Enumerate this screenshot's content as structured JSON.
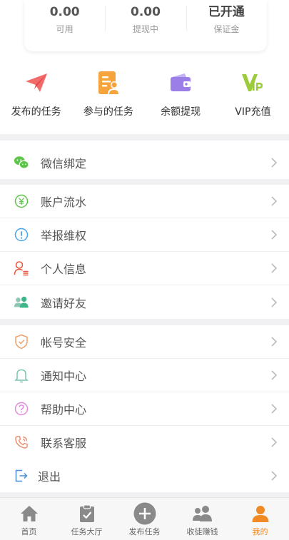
{
  "stats": [
    {
      "value": "0.00",
      "label": "可用"
    },
    {
      "value": "0.00",
      "label": "提现中"
    },
    {
      "value": "已开通",
      "label": "保证金"
    }
  ],
  "quick_actions": [
    {
      "label": "发布的任务",
      "icon": "paper-plane-icon"
    },
    {
      "label": "参与的任务",
      "icon": "task-document-icon"
    },
    {
      "label": "余额提现",
      "icon": "wallet-icon"
    },
    {
      "label": "VIP充值",
      "icon": "vip-icon"
    }
  ],
  "menu": {
    "group1": [
      {
        "label": "微信绑定",
        "icon": "wechat-icon"
      }
    ],
    "group2": [
      {
        "label": "账户流水",
        "icon": "yuan-circle-icon"
      },
      {
        "label": "举报维权",
        "icon": "exclamation-circle-icon"
      },
      {
        "label": "个人信息",
        "icon": "user-info-icon"
      },
      {
        "label": "邀请好友",
        "icon": "friends-icon"
      }
    ],
    "group3": [
      {
        "label": "帐号安全",
        "icon": "shield-icon"
      },
      {
        "label": "通知中心",
        "icon": "bell-icon"
      },
      {
        "label": "帮助中心",
        "icon": "help-circle-icon"
      },
      {
        "label": "联系客服",
        "icon": "phone-icon"
      },
      {
        "label": "退出",
        "icon": "logout-icon"
      }
    ]
  },
  "tabbar": [
    {
      "label": "首页",
      "icon": "home-icon"
    },
    {
      "label": "任务大厅",
      "icon": "clipboard-check-icon"
    },
    {
      "label": "发布任务",
      "icon": "plus-circle-icon"
    },
    {
      "label": "收徒赚钱",
      "icon": "group-icon"
    },
    {
      "label": "我的",
      "icon": "person-icon",
      "active": true
    }
  ],
  "colors": {
    "accent": "#f08a24",
    "plane": "#f26b6b",
    "task": "#f5a33c",
    "wallet": "#9b7ee8",
    "vip": "#9ccc3c",
    "divider": "#f1f1f4"
  }
}
